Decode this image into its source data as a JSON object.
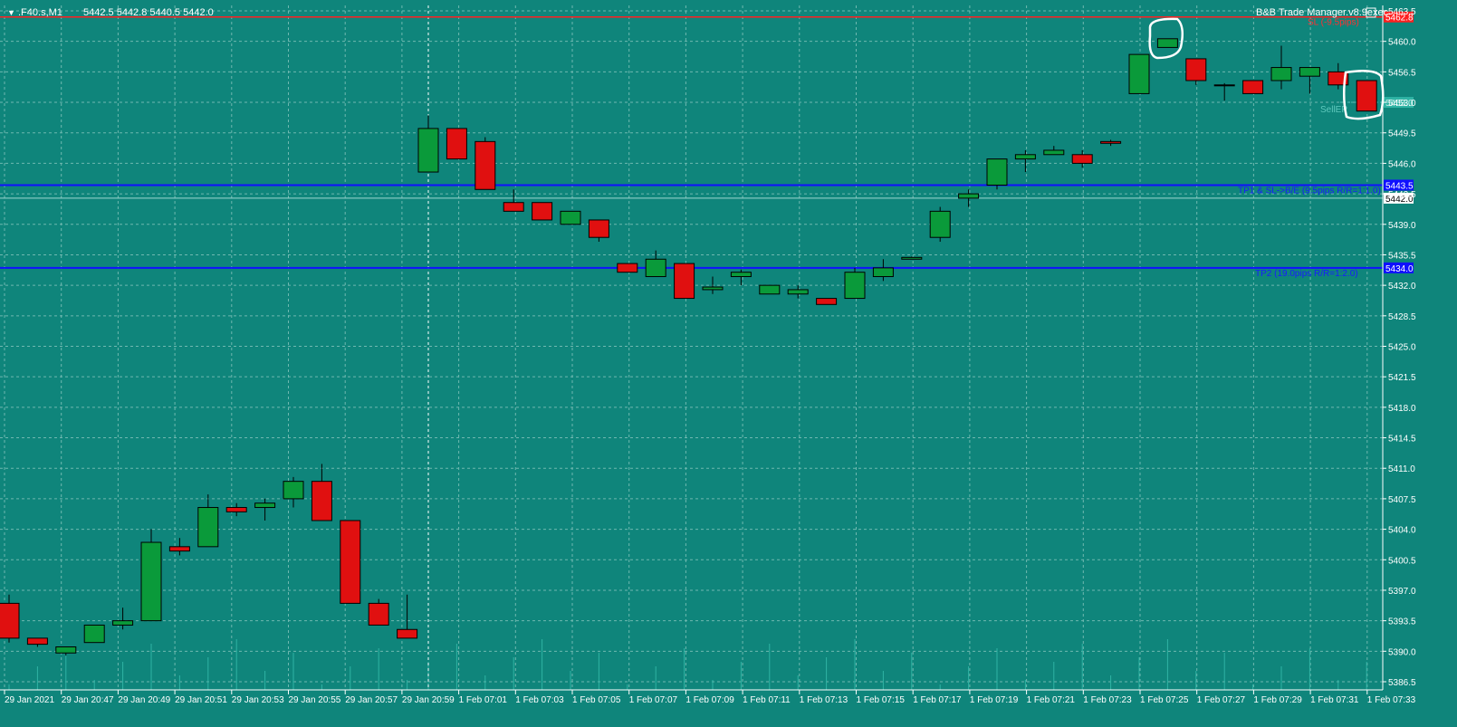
{
  "header": {
    "symbol": ".F40.s,M1",
    "ohlc": "5442.5 5442.8 5440.5 5442.0",
    "ea_name": "B&B Trade Manager.v8.9exec"
  },
  "colors": {
    "background": "#0f857b",
    "grid": "#6fb8b0",
    "bull": "#0a9a3a",
    "bear": "#e01010",
    "sl_line": "#ff2020",
    "tp_line": "#1010ff",
    "text": "#ffffff"
  },
  "lines": {
    "sl": {
      "price": 5462.8,
      "label": "SL (-9.5pips)",
      "tag": "5462.8"
    },
    "tp1": {
      "price": 5443.5,
      "label": "TP1 & SL->B/E (9.5pips R/R=1:1.0)",
      "tag": "5443.5"
    },
    "tp2": {
      "price": 5434.0,
      "label": "TP2 (19.0pips R/R=1:2.0)",
      "tag": "5434.0"
    },
    "entry": {
      "price": 5453.0,
      "label": "SellEP",
      "tag": "5453.0"
    },
    "bid": {
      "price": 5442.0,
      "tag": "5442.0"
    }
  },
  "price_axis": {
    "min": 5386.5,
    "max": 5463.5,
    "ticks": [
      "5463.5",
      "5460.0",
      "5456.5",
      "5453.0",
      "5449.5",
      "5446.0",
      "5442.5",
      "5439.0",
      "5435.5",
      "5432.0",
      "5428.5",
      "5425.0",
      "5421.5",
      "5418.0",
      "5414.5",
      "5411.0",
      "5407.5",
      "5404.0",
      "5400.5",
      "5397.0",
      "5393.5",
      "5390.0",
      "5386.5"
    ]
  },
  "time_axis": {
    "labels": [
      "29 Jan 2021",
      "29 Jan 20:47",
      "29 Jan 20:49",
      "29 Jan 20:51",
      "29 Jan 20:53",
      "29 Jan 20:55",
      "29 Jan 20:57",
      "29 Jan 20:59",
      "1 Feb 07:01",
      "1 Feb 07:03",
      "1 Feb 07:05",
      "1 Feb 07:07",
      "1 Feb 07:09",
      "1 Feb 07:11",
      "1 Feb 07:13",
      "1 Feb 07:15",
      "1 Feb 07:17",
      "1 Feb 07:19",
      "1 Feb 07:21",
      "1 Feb 07:23",
      "1 Feb 07:25",
      "1 Feb 07:27",
      "1 Feb 07:29",
      "1 Feb 07:31",
      "1 Feb 07:33"
    ]
  },
  "chart_data": {
    "type": "candlestick",
    "candles": [
      {
        "o": 5395.5,
        "h": 5396.5,
        "l": 5391.0,
        "c": 5391.5
      },
      {
        "o": 5391.5,
        "h": 5391.5,
        "l": 5390.5,
        "c": 5390.8
      },
      {
        "o": 5389.8,
        "h": 5390.5,
        "l": 5389.5,
        "c": 5390.5
      },
      {
        "o": 5391.0,
        "h": 5393.0,
        "l": 5391.0,
        "c": 5393.0
      },
      {
        "o": 5393.0,
        "h": 5395.0,
        "l": 5392.5,
        "c": 5393.5
      },
      {
        "o": 5393.5,
        "h": 5404.0,
        "l": 5393.5,
        "c": 5402.5
      },
      {
        "o": 5402.0,
        "h": 5403.0,
        "l": 5401.0,
        "c": 5401.5
      },
      {
        "o": 5402.0,
        "h": 5408.0,
        "l": 5402.0,
        "c": 5406.5
      },
      {
        "o": 5406.5,
        "h": 5407.0,
        "l": 5405.5,
        "c": 5406.0
      },
      {
        "o": 5406.5,
        "h": 5407.5,
        "l": 5405.0,
        "c": 5407.0
      },
      {
        "o": 5407.5,
        "h": 5410.0,
        "l": 5406.5,
        "c": 5409.5
      },
      {
        "o": 5409.5,
        "h": 5411.5,
        "l": 5405.0,
        "c": 5405.0
      },
      {
        "o": 5405.0,
        "h": 5405.0,
        "l": 5395.5,
        "c": 5395.5
      },
      {
        "o": 5395.5,
        "h": 5396.0,
        "l": 5393.0,
        "c": 5393.0
      },
      {
        "o": 5392.5,
        "h": 5396.5,
        "l": 5391.5,
        "c": 5391.5
      },
      {
        "o": 5445.0,
        "h": 5451.5,
        "l": 5445.0,
        "c": 5450.0
      },
      {
        "o": 5450.0,
        "h": 5450.0,
        "l": 5446.5,
        "c": 5446.5
      },
      {
        "o": 5448.5,
        "h": 5449.0,
        "l": 5443.0,
        "c": 5443.0
      },
      {
        "o": 5441.5,
        "h": 5443.0,
        "l": 5440.5,
        "c": 5440.5
      },
      {
        "o": 5441.5,
        "h": 5441.5,
        "l": 5439.5,
        "c": 5439.5
      },
      {
        "o": 5439.0,
        "h": 5440.5,
        "l": 5439.0,
        "c": 5440.5
      },
      {
        "o": 5439.5,
        "h": 5439.5,
        "l": 5437.0,
        "c": 5437.5
      },
      {
        "o": 5434.5,
        "h": 5434.5,
        "l": 5433.5,
        "c": 5433.5
      },
      {
        "o": 5433.0,
        "h": 5436.0,
        "l": 5433.0,
        "c": 5435.0
      },
      {
        "o": 5434.5,
        "h": 5434.5,
        "l": 5430.5,
        "c": 5430.5
      },
      {
        "o": 5431.5,
        "h": 5433.0,
        "l": 5431.0,
        "c": 5431.8
      },
      {
        "o": 5433.0,
        "h": 5433.8,
        "l": 5432.0,
        "c": 5433.5
      },
      {
        "o": 5431.0,
        "h": 5432.0,
        "l": 5431.0,
        "c": 5432.0
      },
      {
        "o": 5431.0,
        "h": 5432.0,
        "l": 5430.5,
        "c": 5431.5
      },
      {
        "o": 5430.5,
        "h": 5430.5,
        "l": 5429.8,
        "c": 5429.8
      },
      {
        "o": 5430.5,
        "h": 5434.0,
        "l": 5430.5,
        "c": 5433.5
      },
      {
        "o": 5433.0,
        "h": 5435.0,
        "l": 5432.5,
        "c": 5434.0
      },
      {
        "o": 5435.0,
        "h": 5435.3,
        "l": 5435.0,
        "c": 5435.2
      },
      {
        "o": 5437.5,
        "h": 5441.0,
        "l": 5437.0,
        "c": 5440.5
      },
      {
        "o": 5442.0,
        "h": 5443.0,
        "l": 5441.0,
        "c": 5442.5
      },
      {
        "o": 5443.5,
        "h": 5446.5,
        "l": 5443.0,
        "c": 5446.5
      },
      {
        "o": 5446.5,
        "h": 5447.5,
        "l": 5445.0,
        "c": 5447.0
      },
      {
        "o": 5447.0,
        "h": 5448.0,
        "l": 5447.0,
        "c": 5447.5
      },
      {
        "o": 5447.0,
        "h": 5447.5,
        "l": 5445.5,
        "c": 5446.0
      },
      {
        "o": 5448.5,
        "h": 5448.7,
        "l": 5448.0,
        "c": 5448.3
      },
      {
        "o": 5454.0,
        "h": 5458.5,
        "l": 5454.0,
        "c": 5458.5
      },
      {
        "o": 5459.3,
        "h": 5460.3,
        "l": 5459.3,
        "c": 5460.3
      },
      {
        "o": 5458.0,
        "h": 5458.0,
        "l": 5455.0,
        "c": 5455.5
      },
      {
        "o": 5455.0,
        "h": 5455.2,
        "l": 5453.2,
        "c": 5455.0
      },
      {
        "o": 5455.5,
        "h": 5455.5,
        "l": 5454.0,
        "c": 5454.0
      },
      {
        "o": 5455.5,
        "h": 5459.5,
        "l": 5454.5,
        "c": 5457.0
      },
      {
        "o": 5456.0,
        "h": 5457.0,
        "l": 5454.0,
        "c": 5457.0
      },
      {
        "o": 5456.5,
        "h": 5457.5,
        "l": 5454.5,
        "c": 5455.0
      },
      {
        "o": 5455.5,
        "h": 5455.5,
        "l": 5452.0,
        "c": 5452.0
      }
    ]
  }
}
